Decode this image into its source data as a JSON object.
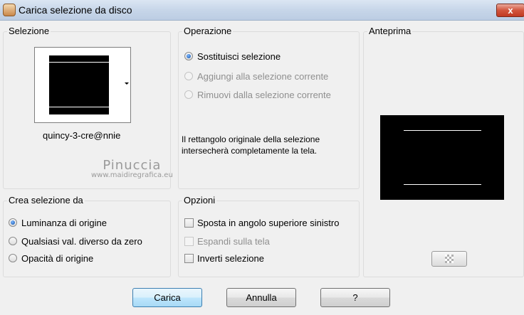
{
  "window": {
    "title": "Carica selezione da disco",
    "close_label": "x"
  },
  "selezione": {
    "title": "Selezione",
    "file_name": "quincy-3-cre@nnie"
  },
  "operazione": {
    "title": "Operazione",
    "options": [
      {
        "label": "Sostituisci selezione",
        "checked": true,
        "disabled": false
      },
      {
        "label": "Aggiungi alla selezione corrente",
        "checked": false,
        "disabled": true
      },
      {
        "label": "Rimuovi dalla selezione corrente",
        "checked": false,
        "disabled": true
      }
    ],
    "info_line1": "Il rettangolo originale della selezione",
    "info_line2": "intersecherà completamente la tela."
  },
  "anteprima": {
    "title": "Anteprima"
  },
  "crea": {
    "title": "Crea selezione da",
    "options": [
      {
        "label": "Luminanza di origine",
        "checked": true
      },
      {
        "label": "Qualsiasi val. diverso da zero",
        "checked": false
      },
      {
        "label": "Opacità di origine",
        "checked": false
      }
    ]
  },
  "opzioni": {
    "title": "Opzioni",
    "options": [
      {
        "label": "Sposta in angolo superiore sinistro",
        "checked": false,
        "disabled": false
      },
      {
        "label": "Espandi sulla tela",
        "checked": false,
        "disabled": true
      },
      {
        "label": "Inverti selezione",
        "checked": false,
        "disabled": false
      }
    ]
  },
  "watermark": {
    "name": "Pinuccia",
    "site": "www.maidiregrafica.eu"
  },
  "buttons": {
    "load": "Carica",
    "cancel": "Annulla",
    "help": "?"
  },
  "icons": {
    "app": "paint-shop-pro-icon",
    "close": "close-icon",
    "dropdown": "chevron-down-icon",
    "transparency": "checkerboard-icon"
  }
}
